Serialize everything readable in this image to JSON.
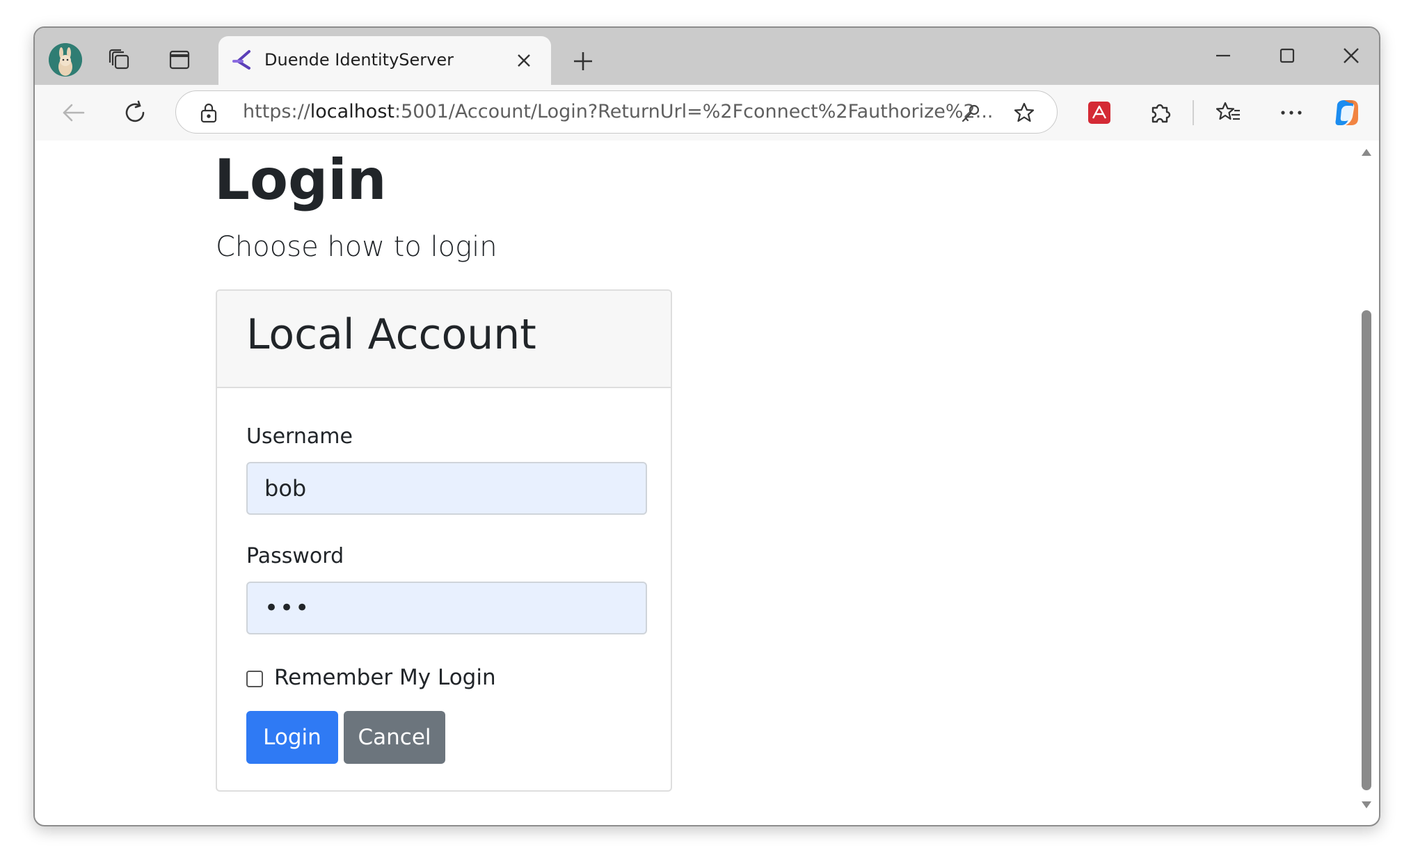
{
  "browser": {
    "tab": {
      "title": "Duende IdentityServer"
    },
    "address": {
      "scheme": "https://",
      "host": "localhost",
      "rest": ":5001/Account/Login?ReturnUrl=%2Fconnect%2Fauthorize%2..."
    },
    "icons": [
      "profile-avatar-icon",
      "workspaces-icon",
      "vertical-tabs-icon",
      "duende-logo-icon",
      "close-tab-icon",
      "new-tab-icon",
      "minimize-icon",
      "maximize-icon",
      "close-window-icon",
      "back-icon",
      "refresh-icon",
      "lock-icon",
      "key-icon",
      "favorite-star-icon",
      "acrobat-extension-icon",
      "extensions-icon",
      "favorites-icon",
      "more-icon",
      "copilot-icon"
    ]
  },
  "page": {
    "title": "Login",
    "subtitle": "Choose how to login",
    "card": {
      "header": "Local Account",
      "username_label": "Username",
      "username_value": "bob",
      "password_label": "Password",
      "password_value": "•••",
      "remember_label": "Remember My Login",
      "remember_checked": false,
      "login_button": "Login",
      "cancel_button": "Cancel"
    }
  },
  "colors": {
    "primary": "#2f7af4",
    "secondary": "#6c757d",
    "autofill": "#e8f0fe"
  }
}
